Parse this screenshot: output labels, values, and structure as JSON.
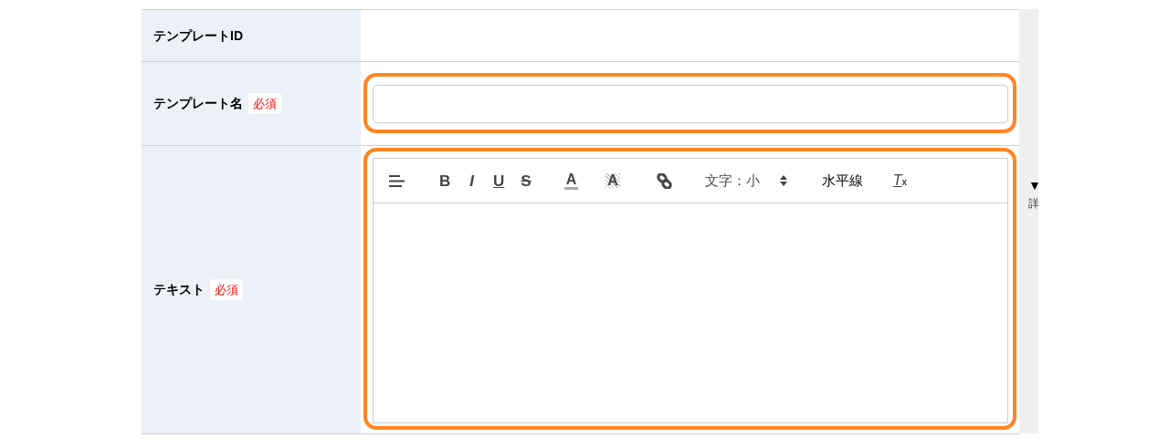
{
  "rows": [
    {
      "label": "テンプレートID",
      "required": null,
      "kind": "display",
      "highlighted": false
    },
    {
      "label": "テンプレート名",
      "required": "必須",
      "kind": "input",
      "highlighted": true
    },
    {
      "label": "テキスト",
      "required": "必須",
      "kind": "editor",
      "highlighted": true
    }
  ],
  "toolbar": [
    {
      "kind": "align"
    },
    {
      "kind": "bold",
      "label": "B"
    },
    {
      "kind": "italic",
      "label": "I"
    },
    {
      "kind": "underline",
      "label": "U"
    },
    {
      "kind": "strike",
      "label": "S"
    },
    {
      "kind": "color",
      "label": "A"
    },
    {
      "kind": "background",
      "label": "A"
    },
    {
      "kind": "link"
    },
    {
      "kind": "select",
      "label": "文字：小"
    },
    {
      "kind": "button",
      "label": "水平線"
    },
    {
      "kind": "clear",
      "label": "T",
      "sub": "x"
    }
  ],
  "side_panel": {
    "arrow": "▼",
    "text": "詳"
  }
}
